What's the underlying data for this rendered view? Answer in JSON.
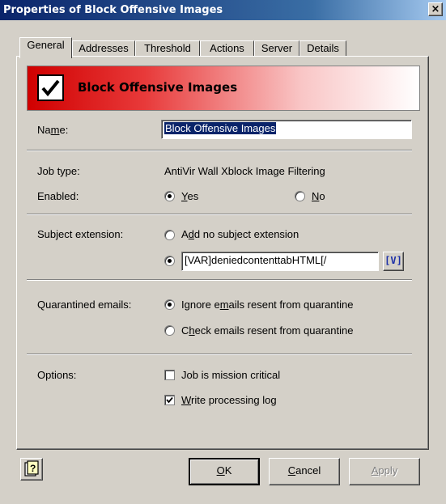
{
  "window": {
    "title": "Properties of Block Offensive Images",
    "close_glyph": "×"
  },
  "tabs": [
    {
      "label": "General",
      "active": true
    },
    {
      "label": "Addresses",
      "active": false
    },
    {
      "label": "Threshold",
      "active": false
    },
    {
      "label": "Actions",
      "active": false
    },
    {
      "label": "Server",
      "active": false
    },
    {
      "label": "Details",
      "active": false
    }
  ],
  "banner": {
    "title": "Block Offensive Images"
  },
  "name": {
    "label_pre": "Na",
    "label_key": "m",
    "label_post": "e:",
    "value": "Block Offensive Images"
  },
  "job_type": {
    "label": "Job type:",
    "value": "AntiVir Wall Xblock Image Filtering"
  },
  "enabled": {
    "label": "Enabled:",
    "yes_key": "Y",
    "yes_rest": "es",
    "no_key": "N",
    "no_rest": "o",
    "selected": "yes"
  },
  "subject_extension": {
    "label": "Subject extension:",
    "opt1_pre": "A",
    "opt1_key": "d",
    "opt1_post": "d no subject extension",
    "value": "[VAR]deniedcontenttabHTML[/",
    "var_button": "[V]",
    "selected": "custom"
  },
  "quarantined": {
    "label": "Quarantined emails:",
    "opt1_pre": "Ignore e",
    "opt1_key": "m",
    "opt1_post": "ails resent from quarantine",
    "opt2_pre": "C",
    "opt2_key": "h",
    "opt2_post": "eck emails resent from quarantine",
    "selected": "ignore"
  },
  "options": {
    "label": "Options:",
    "mission_critical": {
      "label": "Job is mission critical",
      "checked": false
    },
    "processing_log": {
      "key": "W",
      "rest": "rite processing log",
      "checked": true
    }
  },
  "buttons": {
    "ok_key": "O",
    "ok_rest": "K",
    "cancel_key": "C",
    "cancel_rest": "ancel",
    "apply_key": "A",
    "apply_rest": "pply"
  },
  "icons": {
    "help": "help-icon",
    "check": "check-icon"
  }
}
